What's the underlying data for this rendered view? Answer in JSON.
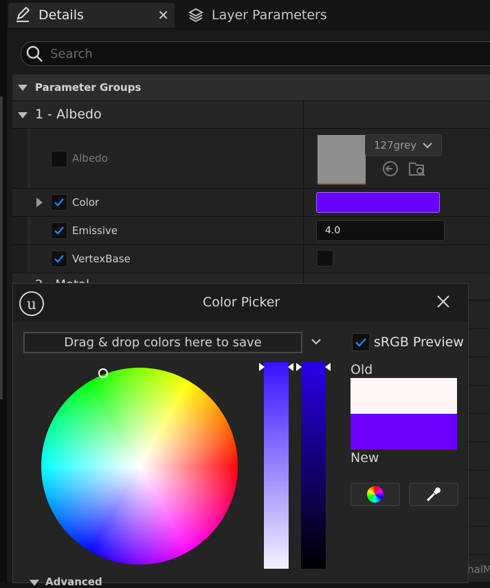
{
  "tabs": [
    {
      "label": "Details",
      "icon": "edit-icon"
    },
    {
      "label": "Layer Parameters",
      "icon": "layers-icon"
    }
  ],
  "search": {
    "placeholder": "Search"
  },
  "parameter_groups": {
    "label": "Parameter Groups"
  },
  "group_albedo": {
    "label": "1 - Albedo"
  },
  "params": {
    "albedo": {
      "label": "Albedo",
      "checked": false,
      "texture_name": "127grey"
    },
    "color": {
      "label": "Color",
      "checked": true,
      "value_color": "#6A00FF"
    },
    "emissive": {
      "label": "Emissive",
      "checked": true,
      "value": "4.0"
    },
    "vertexbase": {
      "label": "VertexBase",
      "checked": true,
      "value_checked": false
    }
  },
  "next_group_partial": "2 - Metal",
  "color_picker": {
    "title": "Color Picker",
    "dropzone_text": "Drag & drop colors here to save",
    "srgb_label": "sRGB Preview",
    "srgb_checked": true,
    "old_label": "Old",
    "new_label": "New",
    "old_color": "#FFF5F5",
    "new_color": "#6A00FF",
    "advanced_label": "Advanced"
  },
  "partial_side_text": "nalM",
  "colors": {
    "accent": "#1a7fe8",
    "selected": "#6A00FF"
  }
}
